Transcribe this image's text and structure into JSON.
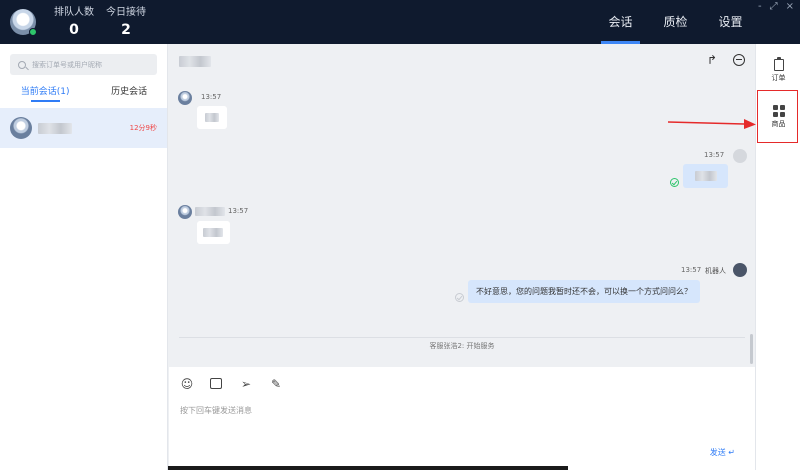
{
  "topbar": {
    "queue_label": "排队人数",
    "queue_count": "0",
    "today_label": "今日接待",
    "today_count": "2",
    "tabs": [
      {
        "label": "会话",
        "active": true
      },
      {
        "label": "质检",
        "active": false
      },
      {
        "label": "设置",
        "active": false
      }
    ],
    "window_controls": [
      "-",
      "⤢",
      "×"
    ]
  },
  "left": {
    "search_placeholder": "搜索订单号或用户昵称",
    "tabs": [
      {
        "label": "当前会话(1)",
        "active": true
      },
      {
        "label": "历史会话",
        "active": false
      }
    ],
    "conversations": [
      {
        "name_blurred": true,
        "wait_time": "12分9秒"
      }
    ]
  },
  "chat": {
    "messages": [
      {
        "side": "left",
        "time": "13:57"
      },
      {
        "side": "right",
        "time": "13:57"
      },
      {
        "side": "left",
        "time": "13:57"
      },
      {
        "side": "right",
        "time": "13:57",
        "sender": "机器人",
        "text": "不好意思，您的问题我暂时还不会，可以换一个方式问问么？"
      }
    ],
    "system_message": "客服张浩2: 开始服务",
    "input_placeholder": "按下回车键发送消息",
    "send_label": "发送 ↵",
    "toolbar_icons": [
      "emoji-icon",
      "image-icon",
      "send-plane-icon",
      "edit-icon"
    ]
  },
  "rail": {
    "items": [
      {
        "label": "订单",
        "icon": "clipboard-icon"
      },
      {
        "label": "商品",
        "icon": "grid-icon"
      }
    ]
  },
  "colors": {
    "topbar_bg": "#0f1a2e",
    "accent": "#2f7cf6",
    "annotation_red": "#e52a2a",
    "timer_red": "#f04848"
  }
}
